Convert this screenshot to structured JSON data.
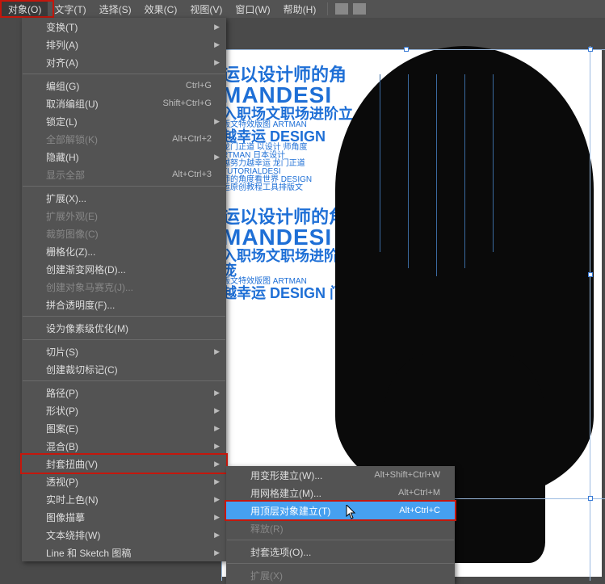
{
  "menubar": {
    "items": [
      "对象(O)",
      "文字(T)",
      "选择(S)",
      "效果(C)",
      "视图(V)",
      "窗口(W)",
      "帮助(H)"
    ],
    "active_index": 0
  },
  "dropdown": {
    "groups": [
      [
        {
          "label": "变换(T)",
          "sub": true
        },
        {
          "label": "排列(A)",
          "sub": true
        },
        {
          "label": "对齐(A)",
          "sub": true
        }
      ],
      [
        {
          "label": "编组(G)",
          "shortcut": "Ctrl+G"
        },
        {
          "label": "取消编组(U)",
          "shortcut": "Shift+Ctrl+G"
        },
        {
          "label": "锁定(L)",
          "sub": true
        },
        {
          "label": "全部解锁(K)",
          "shortcut": "Alt+Ctrl+2",
          "disabled": true
        },
        {
          "label": "隐藏(H)",
          "sub": true
        },
        {
          "label": "显示全部",
          "shortcut": "Alt+Ctrl+3",
          "disabled": true
        }
      ],
      [
        {
          "label": "扩展(X)..."
        },
        {
          "label": "扩展外观(E)",
          "disabled": true
        },
        {
          "label": "裁剪图像(C)",
          "disabled": true
        },
        {
          "label": "栅格化(Z)..."
        },
        {
          "label": "创建渐变网格(D)..."
        },
        {
          "label": "创建对象马赛克(J)...",
          "disabled": true
        },
        {
          "label": "拼合透明度(F)..."
        }
      ],
      [
        {
          "label": "设为像素级优化(M)"
        }
      ],
      [
        {
          "label": "切片(S)",
          "sub": true
        },
        {
          "label": "创建裁切标记(C)"
        }
      ],
      [
        {
          "label": "路径(P)",
          "sub": true
        },
        {
          "label": "形状(P)",
          "sub": true
        },
        {
          "label": "图案(E)",
          "sub": true
        },
        {
          "label": "混合(B)",
          "sub": true
        },
        {
          "label": "封套扭曲(V)",
          "sub": true,
          "highlight": true
        },
        {
          "label": "透视(P)",
          "sub": true
        },
        {
          "label": "实时上色(N)",
          "sub": true
        },
        {
          "label": "图像描摹",
          "sub": true
        },
        {
          "label": "文本绕排(W)",
          "sub": true
        },
        {
          "label": "Line 和 Sketch 图稿",
          "sub": true
        }
      ]
    ]
  },
  "submenu": {
    "groups": [
      [
        {
          "label": "用变形建立(W)...",
          "shortcut": "Alt+Shift+Ctrl+W"
        },
        {
          "label": "用网格建立(M)...",
          "shortcut": "Alt+Ctrl+M"
        },
        {
          "label": "用顶层对象建立(T)",
          "shortcut": "Alt+Ctrl+C",
          "active": true,
          "highlight": true
        },
        {
          "label": "释放(R)",
          "disabled": true
        }
      ],
      [
        {
          "label": "封套选项(O)..."
        }
      ],
      [
        {
          "label": "扩展(X)",
          "disabled": true
        }
      ]
    ]
  },
  "texture": {
    "lines": [
      "运以设计师的角",
      "MANDESI",
      "入职场文职场进阶立",
      "版文特效版图 ARTMAN",
      "越幸运 DESIGN",
      "龙门正道 以设计 师角度",
      "RTMAN 日本设计",
      "越努力越幸运 龙门正道",
      "TUTORIALDESI",
      "师的角度看世界 DESIGN",
      "运原创教程工具排版文",
      "运以设计师的角",
      "MANDESI",
      "入职场文职场进阶立 庞",
      "版文特效版图 ARTMAN",
      "越幸运 DESIGN 门"
    ]
  }
}
